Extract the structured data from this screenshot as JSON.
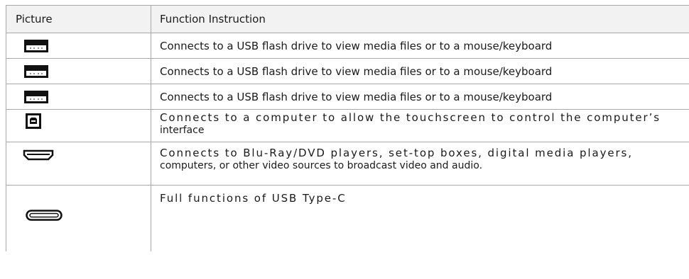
{
  "table": {
    "headers": [
      "Picture",
      "Function Instruction"
    ],
    "rows": [
      {
        "icon": "usb-a-port-icon",
        "text": "Connects to a USB flash drive to view media files or to a mouse/keyboard"
      },
      {
        "icon": "usb-a-port-icon",
        "text": "Connects to a USB flash drive to view media files or to a mouse/keyboard"
      },
      {
        "icon": "usb-a-port-icon",
        "text": "Connects to a USB flash drive to view media files or to a mouse/keyboard"
      },
      {
        "icon": "usb-b-port-icon",
        "line1": "Connects to a computer to allow the touchscreen to control the computer’s",
        "line2": "interface"
      },
      {
        "icon": "hdmi-port-icon",
        "line1": "Connects to Blu-Ray/DVD players, set-top boxes, digital media players,",
        "line2": "computers, or other video sources to broadcast video and audio."
      },
      {
        "icon": "usb-type-c-port-icon",
        "line1": "Full functions of USB Type-C"
      }
    ]
  }
}
